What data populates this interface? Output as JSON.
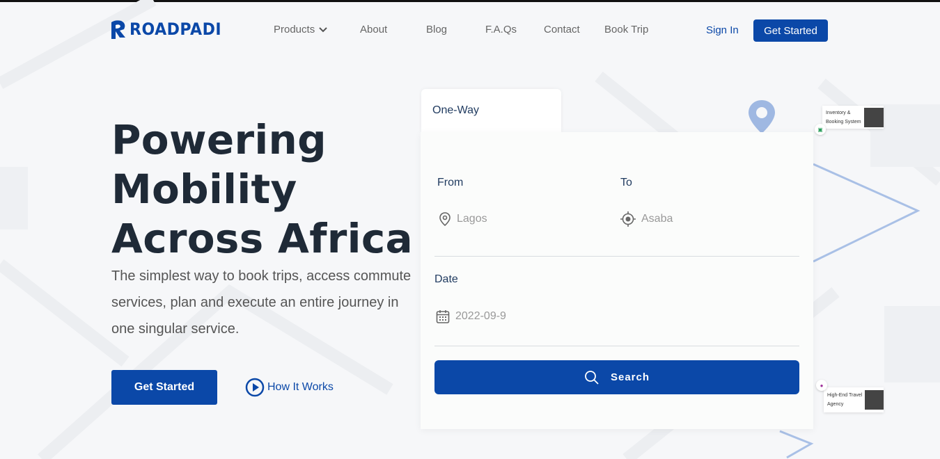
{
  "brand": {
    "name": "ROADPADI",
    "color": "#0b48a8"
  },
  "nav": {
    "products": "Products",
    "about": "About",
    "blog": "Blog",
    "faqs": "F.A.Qs",
    "contact": "Contact",
    "book_trip": "Book Trip",
    "sign_in": "Sign In",
    "get_started": "Get Started"
  },
  "hero": {
    "title_line1": "Powering",
    "title_line2": "Mobility",
    "title_line3": "Across Africa",
    "subtitle": "The simplest way to book trips, access commute services, plan and execute an entire journey in one singular service.",
    "cta": "Get Started",
    "how_it_works": "How It Works"
  },
  "booking": {
    "tab": "One-Way",
    "from_label": "From",
    "from_value": "Lagos",
    "to_label": "To",
    "to_value": "Asaba",
    "date_label": "Date",
    "date_value": "2022-09-9",
    "search": "Search"
  },
  "widgets": {
    "card1_text": "Inventory & Booking System",
    "card2_text": "High-End Travel Agency"
  },
  "icons": {
    "products_chevron": "chevron-down-icon",
    "how_play": "play-circle-icon",
    "from": "map-pin-icon",
    "to": "crosshair-icon",
    "date": "calendar-icon",
    "search": "search-icon"
  }
}
